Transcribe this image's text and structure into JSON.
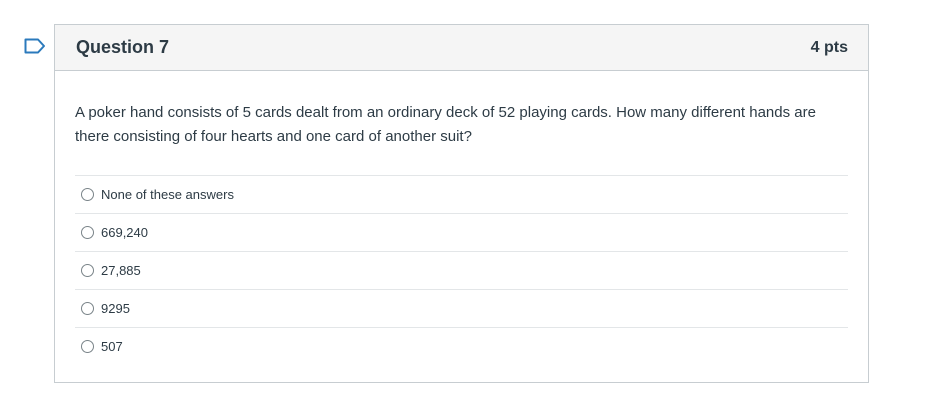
{
  "icons": {
    "flag": "flag-outline-icon"
  },
  "colors": {
    "flag": "#2b7abc",
    "header_bg": "#f5f5f5",
    "border": "#c7cdd1",
    "text": "#2d3b45"
  },
  "question": {
    "title": "Question 7",
    "points": "4 pts",
    "text": "A poker hand consists of 5 cards dealt from an ordinary deck of 52 playing cards. How many different hands are there consisting of four hearts and one card of another suit?",
    "answers": [
      {
        "label": "None of these answers",
        "selected": false
      },
      {
        "label": "669,240",
        "selected": false
      },
      {
        "label": "27,885",
        "selected": false
      },
      {
        "label": "9295",
        "selected": false
      },
      {
        "label": "507",
        "selected": false
      }
    ]
  }
}
